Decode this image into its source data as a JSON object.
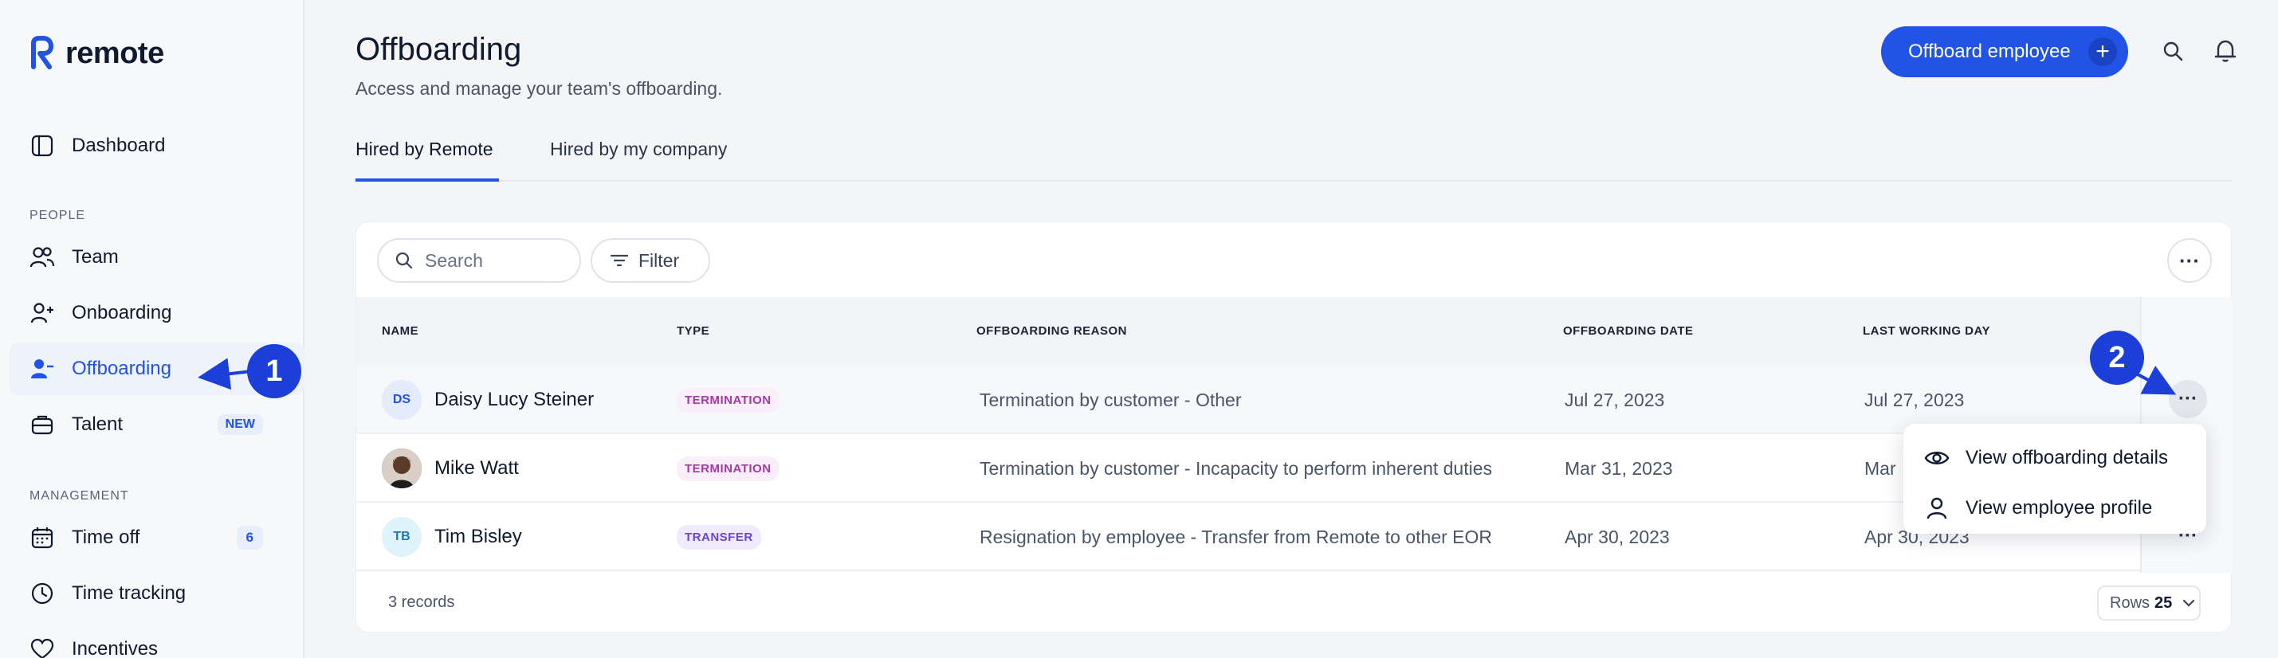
{
  "brand": {
    "name": "remote"
  },
  "sidebar": {
    "dashboard": "Dashboard",
    "people_section": "PEOPLE",
    "team": "Team",
    "onboarding": "Onboarding",
    "offboarding": "Offboarding",
    "talent": "Talent",
    "talent_badge": "NEW",
    "management_section": "MANAGEMENT",
    "time_off": "Time off",
    "time_off_badge": "6",
    "time_tracking": "Time tracking",
    "incentives": "Incentives"
  },
  "header": {
    "title": "Offboarding",
    "subtitle": "Access and manage your team's offboarding.",
    "primary_button": "Offboard employee"
  },
  "tabs": [
    {
      "label": "Hired by Remote",
      "active": true
    },
    {
      "label": "Hired by my company",
      "active": false
    }
  ],
  "toolbar": {
    "search_placeholder": "Search",
    "filter_label": "Filter"
  },
  "table": {
    "columns": [
      "NAME",
      "TYPE",
      "OFFBOARDING REASON",
      "OFFBOARDING DATE",
      "LAST WORKING DAY"
    ],
    "rows": [
      {
        "initials": "DS",
        "name": "Daisy Lucy Steiner",
        "type": "TERMINATION",
        "reason": "Termination by customer - Other",
        "offboarding_date": "Jul 27, 2023",
        "last_working_day": "Jul 27, 2023"
      },
      {
        "initials": "",
        "name": "Mike Watt",
        "type": "TERMINATION",
        "reason": "Termination by customer - Incapacity to perform inherent duties",
        "offboarding_date": "Mar 31, 2023",
        "last_working_day": "Mar"
      },
      {
        "initials": "TB",
        "name": "Tim Bisley",
        "type": "TRANSFER",
        "reason": "Resignation by employee - Transfer from Remote to other EOR",
        "offboarding_date": "Apr 30, 2023",
        "last_working_day": "Apr 30, 2023"
      }
    ],
    "records": "3 records",
    "rows_label": "Rows",
    "rows_value": "25"
  },
  "row_menu": {
    "view_details": "View offboarding details",
    "view_profile": "View employee profile"
  },
  "annotations": {
    "marker_1": "1",
    "marker_2": "2"
  },
  "colors": {
    "accent": "#2153e6",
    "marker": "#1b3fd8",
    "termination": "#a33aa8",
    "transfer": "#6b44d2"
  }
}
